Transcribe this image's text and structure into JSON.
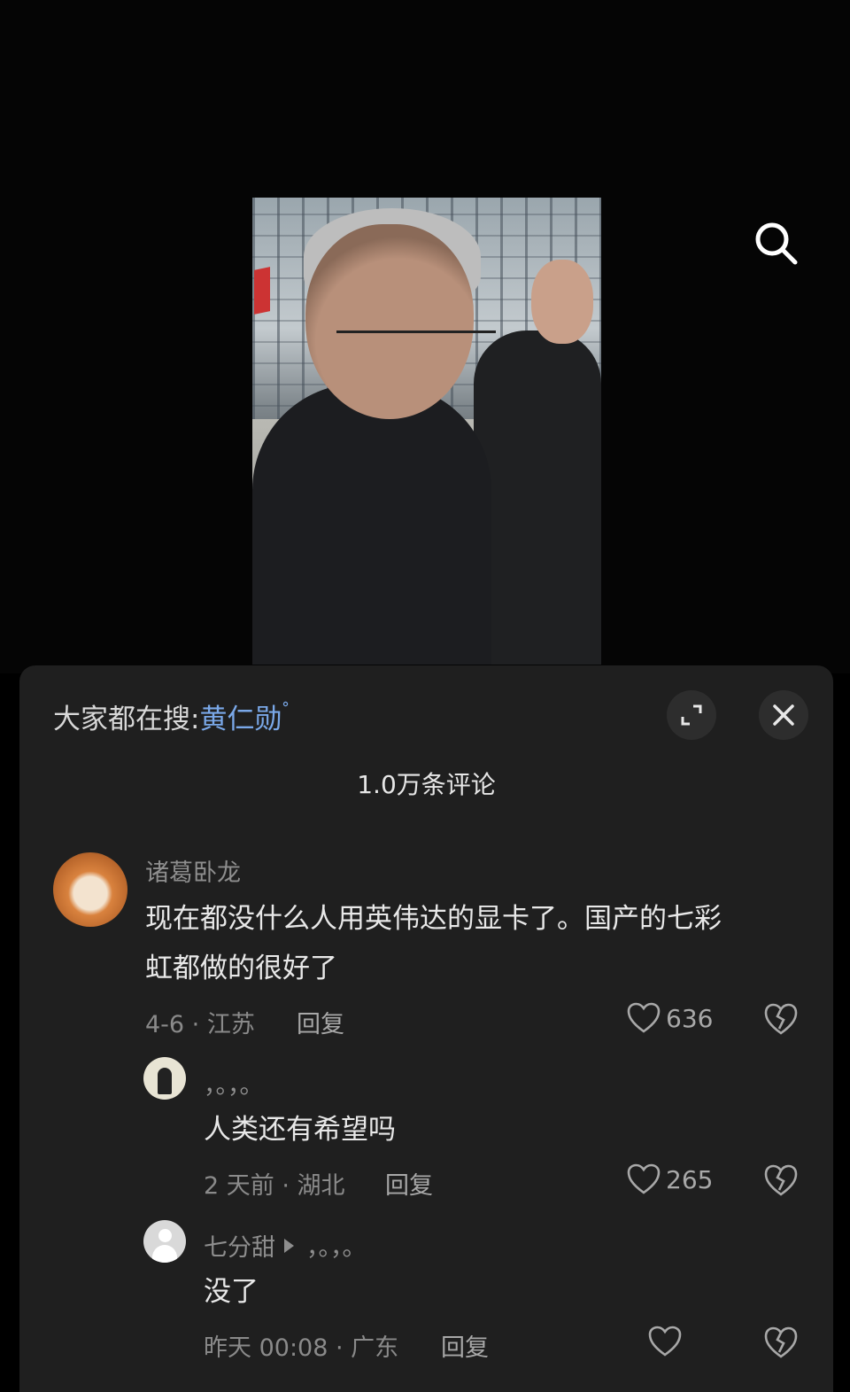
{
  "header": {
    "search_icon": "search-icon"
  },
  "sheet": {
    "trend_prefix": "大家都在搜:",
    "trend_keyword": "黄仁勋",
    "expand_icon": "expand-icon",
    "close_icon": "close-icon",
    "comment_count": "1.0万条评论"
  },
  "comments": [
    {
      "user": "诸葛卧龙",
      "line1": "现在都没什么人用英伟达的显卡了。国产的七彩",
      "line2": "虹都做的很好了",
      "meta": "4-6 · 江苏",
      "reply": "回复",
      "likes": "636"
    },
    {
      "user": "，。，。",
      "text": "人类还有希望吗",
      "meta": "2 天前 · 湖北",
      "reply": "回复",
      "likes": "265"
    },
    {
      "user": "七分甜",
      "reply_to": "，。，。",
      "text": "没了",
      "meta": "昨天 00:08 · 广东",
      "reply": "回复"
    }
  ]
}
